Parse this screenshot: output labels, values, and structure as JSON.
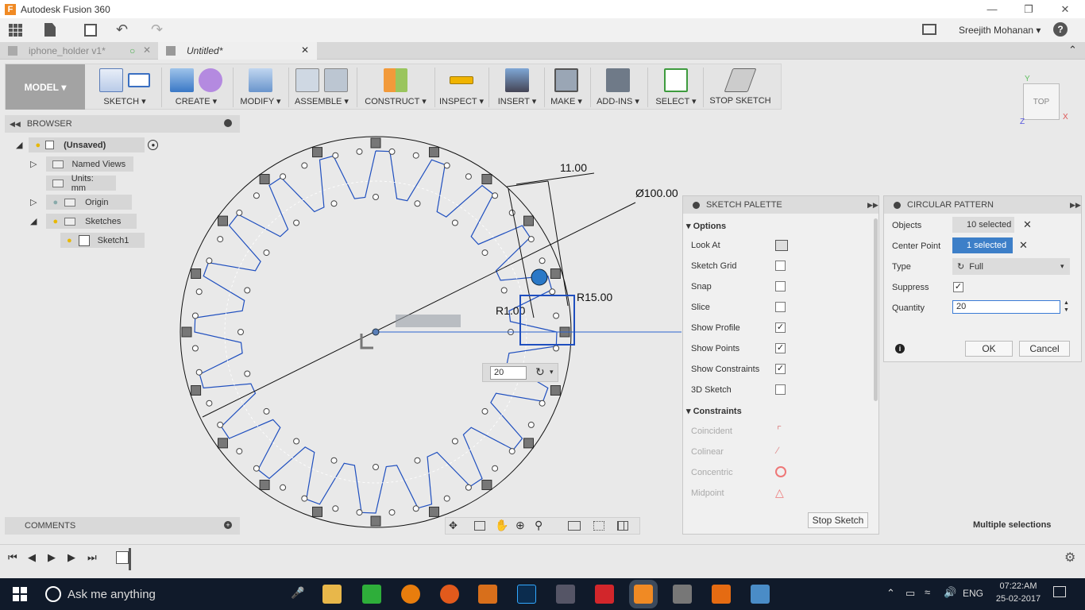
{
  "app": {
    "title": "Autodesk Fusion 360",
    "user": "Sreejith Mohanan",
    "help": "?"
  },
  "tabs": [
    {
      "label": "iphone_holder v1*"
    },
    {
      "label": "Untitled*"
    }
  ],
  "toolbar": {
    "mode": "MODEL",
    "groups": [
      "SKETCH",
      "CREATE",
      "MODIFY",
      "ASSEMBLE",
      "CONSTRUCT",
      "INSPECT",
      "INSERT",
      "MAKE",
      "ADD-INS",
      "SELECT",
      "STOP SKETCH"
    ]
  },
  "browser": {
    "title": "BROWSER",
    "items": [
      "(Unsaved)",
      "Named Views",
      "Units: mm",
      "Origin",
      "Sketches",
      "Sketch1"
    ]
  },
  "canvas": {
    "dim_diameter": "Ø100.00",
    "dim_11": "11.00",
    "dim_r15": "R15.00",
    "dim_r1": "R1.00",
    "quantity_input": "20"
  },
  "palette": {
    "title": "SKETCH PALETTE",
    "options_header": "Options",
    "options": [
      {
        "label": "Look At",
        "type": "icon"
      },
      {
        "label": "Sketch Grid",
        "checked": false
      },
      {
        "label": "Snap",
        "checked": false
      },
      {
        "label": "Slice",
        "checked": false
      },
      {
        "label": "Show Profile",
        "checked": true
      },
      {
        "label": "Show Points",
        "checked": true
      },
      {
        "label": "Show Constraints",
        "checked": true
      },
      {
        "label": "3D Sketch",
        "checked": false
      }
    ],
    "constraints_header": "Constraints",
    "constraints": [
      "Coincident",
      "Colinear",
      "Concentric",
      "Midpoint"
    ],
    "stop_button": "Stop Sketch"
  },
  "circular_pattern": {
    "title": "CIRCULAR PATTERN",
    "objects_label": "Objects",
    "objects_value": "10 selected",
    "center_label": "Center Point",
    "center_value": "1 selected",
    "type_label": "Type",
    "type_value": "Full",
    "suppress_label": "Suppress",
    "quantity_label": "Quantity",
    "quantity_value": "20",
    "ok": "OK",
    "cancel": "Cancel"
  },
  "comments": {
    "title": "COMMENTS"
  },
  "status": {
    "text": "Multiple selections"
  },
  "viewcube": {
    "face": "TOP"
  },
  "taskbar": {
    "search": "Ask me anything",
    "lang": "ENG",
    "time": "07:22:AM",
    "date": "25-02-2017"
  },
  "colors": {
    "accent": "#2a78c7",
    "toolbar_model": "#a3a3a3",
    "taskbar": "#101a2a",
    "sketch_blue": "#1f4fbf"
  }
}
